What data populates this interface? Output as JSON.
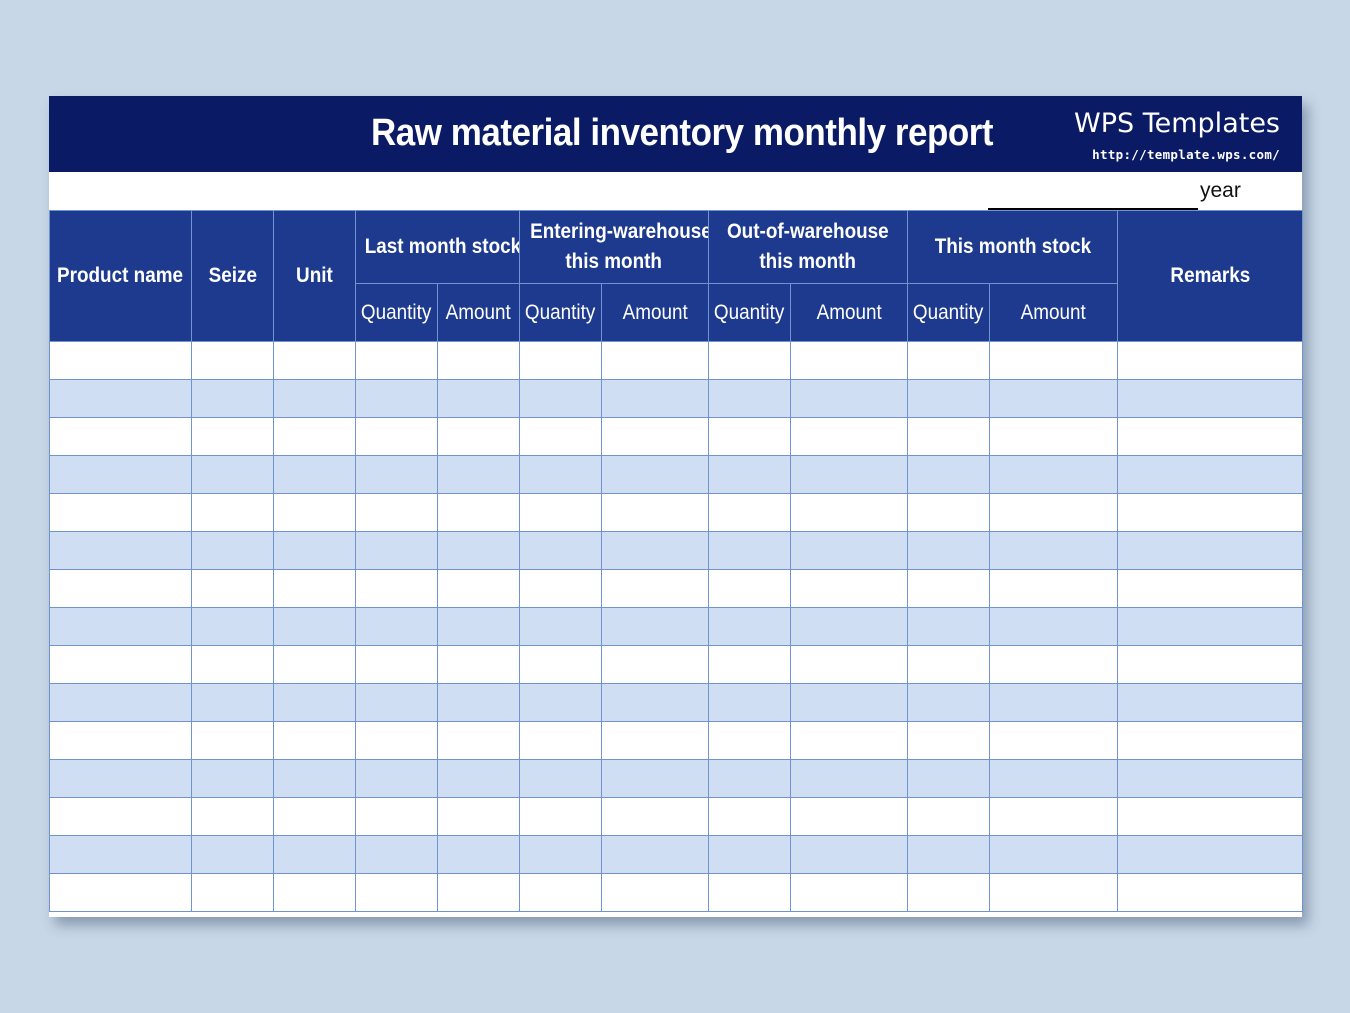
{
  "report": {
    "title": "Raw material inventory monthly report",
    "brand_name": "WPS Templates",
    "brand_url": "http://template.wps.com/",
    "year_label": "year"
  },
  "table": {
    "headers": {
      "product_name": "Product name",
      "seize": "Seize",
      "unit": "Unit",
      "last_month_stock": "Last month stock",
      "entering_line1": "Entering-warehouse",
      "entering_line2": "this month",
      "out_line1": "Out-of-warehouse",
      "out_line2": "this month",
      "this_month_stock": "This month stock",
      "remarks": "Remarks"
    },
    "sub_headers": [
      "Quantity",
      "Amount",
      "Quantity",
      "Amount",
      "Quantity",
      "Amount",
      "Quantity",
      "Amount"
    ],
    "empty_row_count": 15
  },
  "colors": {
    "title_bar": "#0a1a64",
    "header_fill": "#1d3a8e",
    "stripe_fill": "#cfdef2",
    "grid_line": "#6f94cf",
    "background": "#c7d7e7"
  }
}
